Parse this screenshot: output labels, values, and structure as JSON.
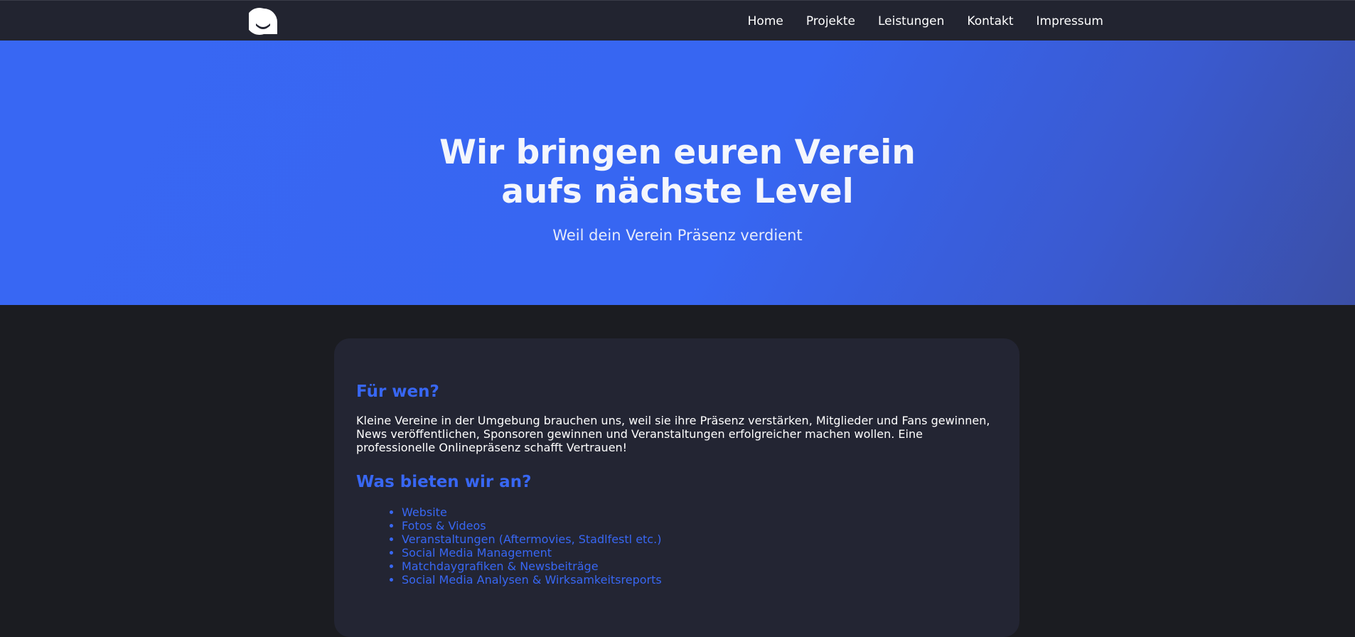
{
  "nav": {
    "logo_icon": "a-logo-icon",
    "links": [
      "Home",
      "Projekte",
      "Leistungen",
      "Kontakt",
      "Impressum"
    ]
  },
  "hero": {
    "title_line1": "Wir bringen euren Verein",
    "title_line2": "aufs nächste Level",
    "subtitle": "Weil dein Verein Präsenz verdient"
  },
  "content": {
    "heading1": "Für wen?",
    "paragraph1": "Kleine Vereine in der Umgebung brauchen uns, weil sie ihre Präsenz verstärken, Mitglieder und Fans gewinnen, News veröffentlichen, Sponsoren gewinnen und Veranstaltungen erfolgreicher machen wollen. Eine professionelle Onlinepräsenz schafft Vertrauen!",
    "heading2": "Was bieten wir an?",
    "offers": [
      "Website",
      "Fotos & Videos",
      "Veranstaltungen (Aftermovies, Stadlfestl etc.)",
      "Social Media Management",
      "Matchdaygrafiken & Newsbeiträge",
      "Social Media Analysen & Wirksamkeitsreports"
    ]
  },
  "colors": {
    "accent": "#3867f3",
    "nav_bg": "#222430",
    "page_bg": "#1b1c21",
    "card_bg": "#232533"
  }
}
